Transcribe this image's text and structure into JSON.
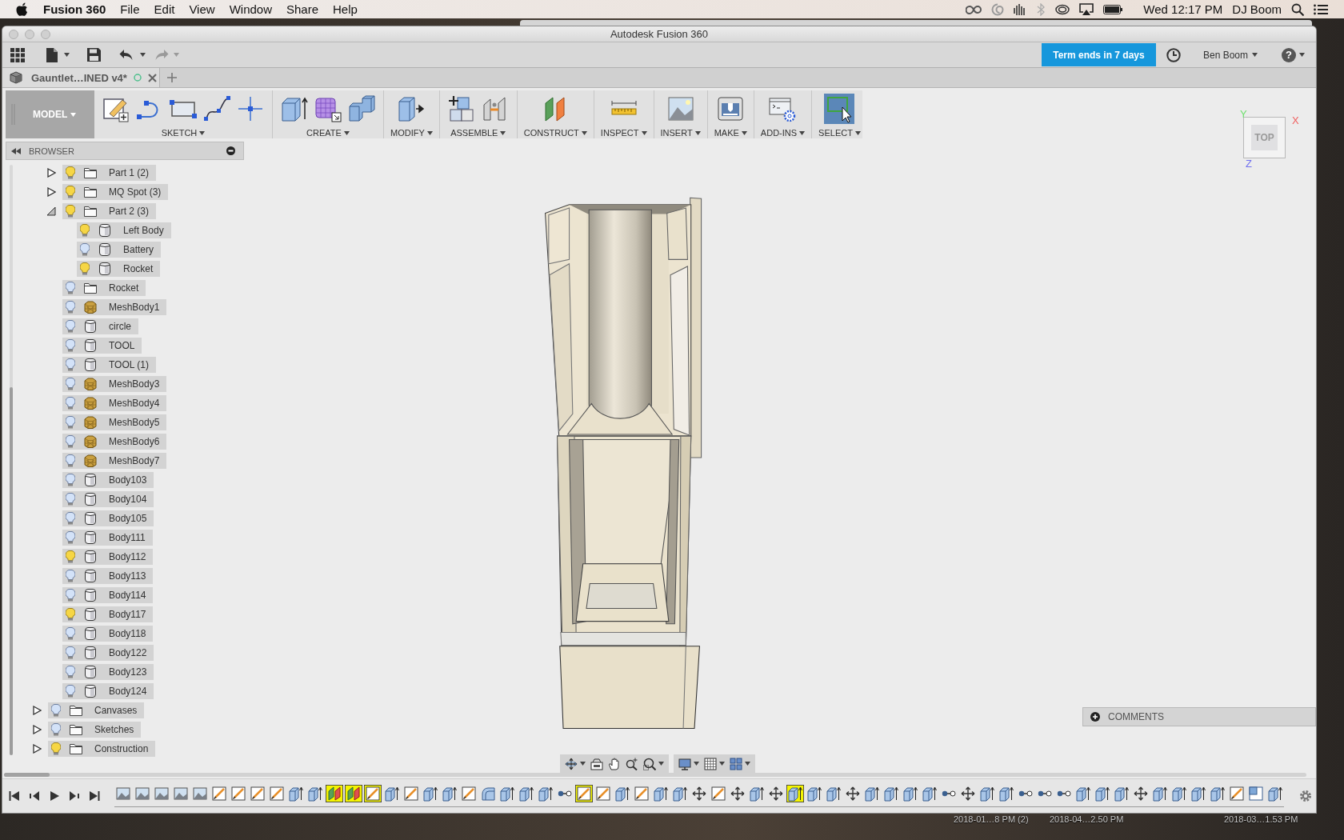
{
  "menu_bar": {
    "app_name": "Fusion 360",
    "menus": [
      "File",
      "Edit",
      "View",
      "Window",
      "Share",
      "Help"
    ],
    "clock": "Wed 12:17 PM",
    "user": "DJ Boom"
  },
  "window": {
    "title": "Autodesk Fusion 360"
  },
  "toolbar": {
    "trial_badge": "Term ends in 7 days",
    "user": "Ben Boom",
    "help": "?"
  },
  "document_tabs": [
    {
      "label": "Gauntlet…INED v4*",
      "selected": true
    }
  ],
  "ribbon": {
    "workspace": "MODEL",
    "groups": [
      {
        "label": "SKETCH",
        "tools": [
          {
            "kind": "sketch",
            "active": false
          },
          {
            "kind": "arc",
            "active": false
          },
          {
            "kind": "rectangle",
            "active": false
          },
          {
            "kind": "spline",
            "active": false
          },
          {
            "kind": "point",
            "active": false
          }
        ]
      },
      {
        "label": "CREATE",
        "tools": [
          {
            "kind": "extrude",
            "active": false
          },
          {
            "kind": "form",
            "active": false
          },
          {
            "kind": "pipe",
            "active": false
          }
        ]
      },
      {
        "label": "MODIFY",
        "tools": [
          {
            "kind": "press-pull",
            "active": false
          }
        ]
      },
      {
        "label": "ASSEMBLE",
        "tools": [
          {
            "kind": "component",
            "active": false
          },
          {
            "kind": "joint",
            "active": false
          }
        ]
      },
      {
        "label": "CONSTRUCT",
        "tools": [
          {
            "kind": "plane",
            "active": false
          }
        ]
      },
      {
        "label": "INSPECT",
        "tools": [
          {
            "kind": "measure",
            "active": false
          }
        ]
      },
      {
        "label": "INSERT",
        "tools": [
          {
            "kind": "image",
            "active": false
          }
        ]
      },
      {
        "label": "MAKE",
        "tools": [
          {
            "kind": "printer",
            "active": false
          }
        ]
      },
      {
        "label": "ADD-INS",
        "tools": [
          {
            "kind": "script",
            "active": false
          }
        ]
      },
      {
        "label": "SELECT",
        "tools": [
          {
            "kind": "select",
            "active": true
          }
        ]
      }
    ]
  },
  "browser": {
    "title": "BROWSER",
    "nested_items": [
      {
        "label": "Part 1 (2)",
        "kind": "folder",
        "visible": true,
        "expanded": false
      },
      {
        "label": "MQ Spot (3)",
        "kind": "folder",
        "visible": true,
        "expanded": false
      },
      {
        "label": "Part 2 (3)",
        "kind": "folder",
        "visible": true,
        "expanded": true,
        "children": [
          {
            "label": "Left Body",
            "kind": "body",
            "visible": true
          },
          {
            "label": "Battery",
            "kind": "body",
            "visible": false
          },
          {
            "label": "Rocket",
            "kind": "body",
            "visible": true
          }
        ]
      },
      {
        "label": "Rocket",
        "kind": "folder",
        "visible": false
      },
      {
        "label": "MeshBody1",
        "kind": "mesh",
        "visible": false
      },
      {
        "label": "circle",
        "kind": "body",
        "visible": false
      },
      {
        "label": "TOOL",
        "kind": "body",
        "visible": false
      },
      {
        "label": "TOOL (1)",
        "kind": "body",
        "visible": false
      },
      {
        "label": "MeshBody3",
        "kind": "mesh",
        "visible": false
      },
      {
        "label": "MeshBody4",
        "kind": "mesh",
        "visible": false
      },
      {
        "label": "MeshBody5",
        "kind": "mesh",
        "visible": false
      },
      {
        "label": "MeshBody6",
        "kind": "mesh",
        "visible": false
      },
      {
        "label": "MeshBody7",
        "kind": "mesh",
        "visible": false
      },
      {
        "label": "Body103",
        "kind": "body",
        "visible": false
      },
      {
        "label": "Body104",
        "kind": "body",
        "visible": false
      },
      {
        "label": "Body105",
        "kind": "body",
        "visible": false
      },
      {
        "label": "Body111",
        "kind": "body",
        "visible": false
      },
      {
        "label": "Body112",
        "kind": "body",
        "visible": true
      },
      {
        "label": "Body113",
        "kind": "body",
        "visible": false
      },
      {
        "label": "Body114",
        "kind": "body",
        "visible": false
      },
      {
        "label": "Body117",
        "kind": "body",
        "visible": true
      },
      {
        "label": "Body118",
        "kind": "body",
        "visible": false
      },
      {
        "label": "Body122",
        "kind": "body",
        "visible": false
      },
      {
        "label": "Body123",
        "kind": "body",
        "visible": false
      },
      {
        "label": "Body124",
        "kind": "body",
        "visible": false
      }
    ],
    "items": [
      {
        "label": "Canvases",
        "kind": "folder",
        "visible": false,
        "expanded": false
      },
      {
        "label": "Sketches",
        "kind": "folder",
        "visible": false,
        "expanded": false
      },
      {
        "label": "Construction",
        "kind": "folder",
        "visible": true,
        "expanded": false
      }
    ]
  },
  "viewcube": {
    "face": "TOP",
    "axes": [
      {
        "label": "Y",
        "color": "#6ee06e"
      },
      {
        "label": "X",
        "color": "#f06060"
      },
      {
        "label": "Z",
        "color": "#7070f0"
      }
    ]
  },
  "comments": {
    "label": "COMMENTS"
  },
  "timeline": {
    "features": [
      {
        "kind": "image",
        "warning": false
      },
      {
        "kind": "image",
        "warning": false
      },
      {
        "kind": "image",
        "warning": false
      },
      {
        "kind": "image",
        "warning": false
      },
      {
        "kind": "image",
        "warning": false
      },
      {
        "kind": "sketch",
        "warning": false
      },
      {
        "kind": "sketch",
        "warning": false
      },
      {
        "kind": "sketch",
        "warning": false
      },
      {
        "kind": "sketch",
        "warning": false
      },
      {
        "kind": "extrude",
        "warning": false
      },
      {
        "kind": "extrude",
        "warning": false
      },
      {
        "kind": "plane",
        "warning": true
      },
      {
        "kind": "plane",
        "warning": true
      },
      {
        "kind": "sketch",
        "warning": true
      },
      {
        "kind": "extrude",
        "warning": false
      },
      {
        "kind": "sketch",
        "warning": false
      },
      {
        "kind": "extrude",
        "warning": false
      },
      {
        "kind": "extrude",
        "warning": false
      },
      {
        "kind": "sketch",
        "warning": false
      },
      {
        "kind": "fillet",
        "warning": false
      },
      {
        "kind": "extrude",
        "warning": false
      },
      {
        "kind": "extrude",
        "warning": false
      },
      {
        "kind": "extrude",
        "warning": false
      },
      {
        "kind": "joint",
        "warning": false
      },
      {
        "kind": "sketch",
        "warning": true
      },
      {
        "kind": "sketch",
        "warning": false
      },
      {
        "kind": "extrude",
        "warning": false
      },
      {
        "kind": "sketch",
        "warning": false
      },
      {
        "kind": "extrude",
        "warning": false
      },
      {
        "kind": "extrude",
        "warning": false
      },
      {
        "kind": "move",
        "warning": false
      },
      {
        "kind": "sketch",
        "warning": false
      },
      {
        "kind": "move",
        "warning": false
      },
      {
        "kind": "extrude",
        "warning": false
      },
      {
        "kind": "move",
        "warning": false
      },
      {
        "kind": "extrude",
        "warning": true
      },
      {
        "kind": "extrude",
        "warning": false
      },
      {
        "kind": "extrude",
        "warning": false
      },
      {
        "kind": "move",
        "warning": false
      },
      {
        "kind": "extrude",
        "warning": false
      },
      {
        "kind": "extrude",
        "warning": false
      },
      {
        "kind": "extrude",
        "warning": false
      },
      {
        "kind": "extrude",
        "warning": false
      },
      {
        "kind": "joint",
        "warning": false
      },
      {
        "kind": "move",
        "warning": false
      },
      {
        "kind": "extrude",
        "warning": false
      },
      {
        "kind": "extrude",
        "warning": false
      },
      {
        "kind": "joint",
        "warning": false
      },
      {
        "kind": "joint",
        "warning": false
      },
      {
        "kind": "joint",
        "warning": false
      },
      {
        "kind": "extrude",
        "warning": false
      },
      {
        "kind": "extrude",
        "warning": false
      },
      {
        "kind": "extrude",
        "warning": false
      },
      {
        "kind": "move",
        "warning": false
      },
      {
        "kind": "extrude",
        "warning": false
      },
      {
        "kind": "extrude",
        "warning": false
      },
      {
        "kind": "extrude",
        "warning": false
      },
      {
        "kind": "extrude",
        "warning": false
      },
      {
        "kind": "sketch",
        "warning": false
      },
      {
        "kind": "combine",
        "warning": false
      },
      {
        "kind": "extrude",
        "warning": false
      }
    ]
  },
  "desktop": {
    "files": [
      "2018-01…8 PM (2)",
      "2018-04…2.50 PM",
      "2018-03…1.53 PM"
    ]
  }
}
